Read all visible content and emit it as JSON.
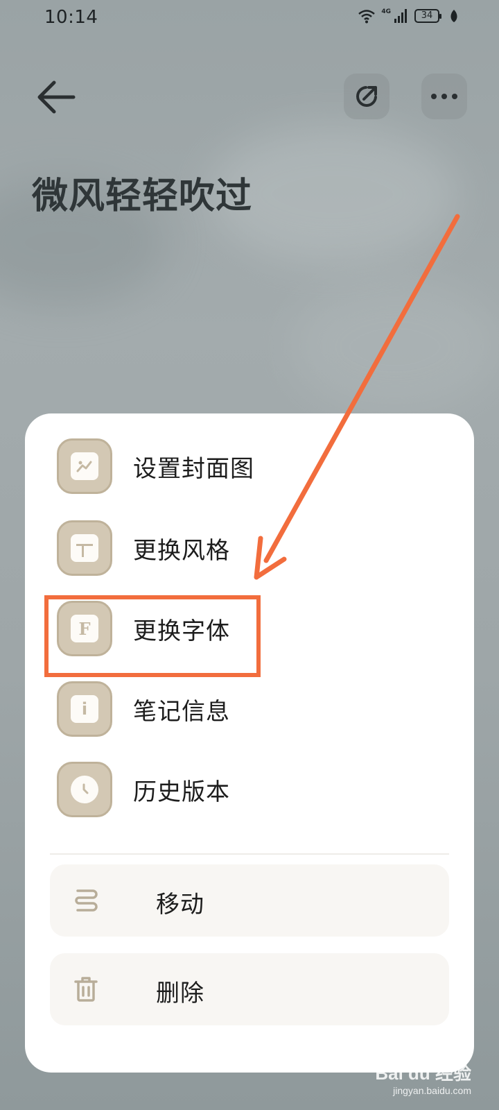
{
  "status_bar": {
    "time": "10:14",
    "network": "4G",
    "battery": "34"
  },
  "icons": {
    "back": "arrow-left-icon",
    "share": "share-icon",
    "more": "more-horizontal-icon",
    "cover": "image-icon",
    "style": "layout-icon",
    "font": "font-icon",
    "info": "info-icon",
    "history": "clock-icon",
    "move": "move-icon",
    "delete": "trash-icon"
  },
  "note": {
    "title": "微风轻轻吹过"
  },
  "menu": {
    "items": [
      {
        "label": "设置封面图"
      },
      {
        "label": "更换风格"
      },
      {
        "label": "更换字体"
      },
      {
        "label": "笔记信息"
      },
      {
        "label": "历史版本"
      }
    ],
    "actions": [
      {
        "label": "移动"
      },
      {
        "label": "删除"
      }
    ]
  },
  "font_icon_letter": "F",
  "info_icon_letter": "i",
  "colors": {
    "accent": "#f26d3d",
    "icon_bg": "#d3c8b4",
    "sheet": "#ffffff"
  },
  "watermark": {
    "main": "Bai du 经验",
    "sub": "jingyan.baidu.com"
  }
}
